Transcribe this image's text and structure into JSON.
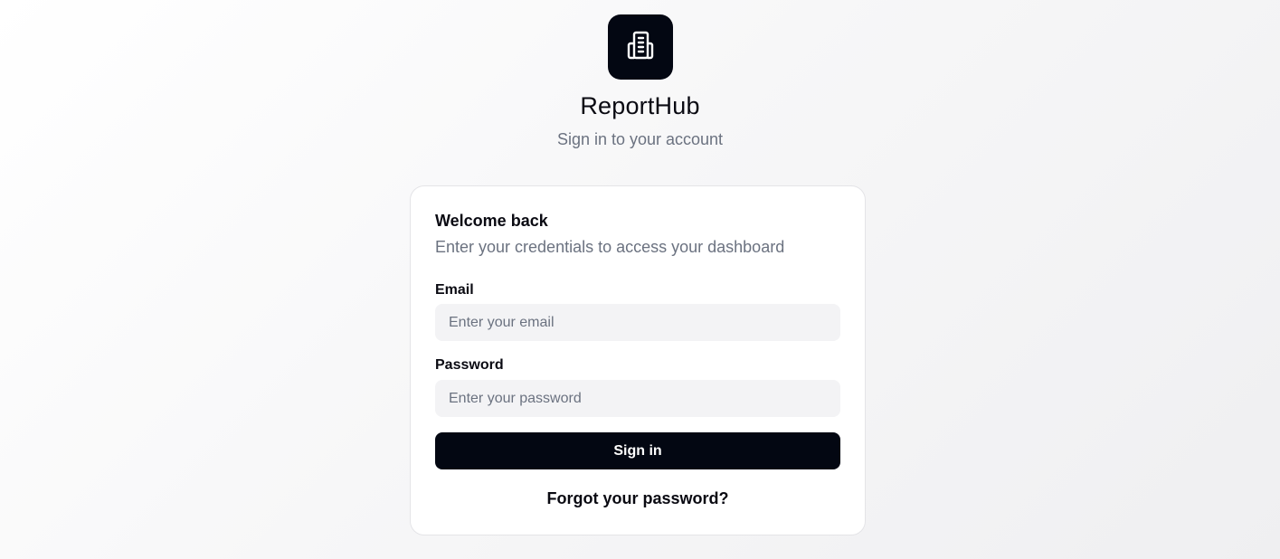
{
  "brand": {
    "logo_icon": "building-icon",
    "title": "ReportHub",
    "subtitle": "Sign in to your account"
  },
  "login_card": {
    "title": "Welcome back",
    "description": "Enter your credentials to access your dashboard",
    "email": {
      "label": "Email",
      "value": "",
      "placeholder": "Enter your email"
    },
    "password": {
      "label": "Password",
      "value": "",
      "placeholder": "Enter your password"
    },
    "signin_label": "Sign in",
    "forgot_label": "Forgot your password?"
  },
  "colors": {
    "primary": "#030712",
    "muted_text": "#6b7280",
    "input_background": "#f3f3f5",
    "card_border": "#e4e4e7"
  }
}
